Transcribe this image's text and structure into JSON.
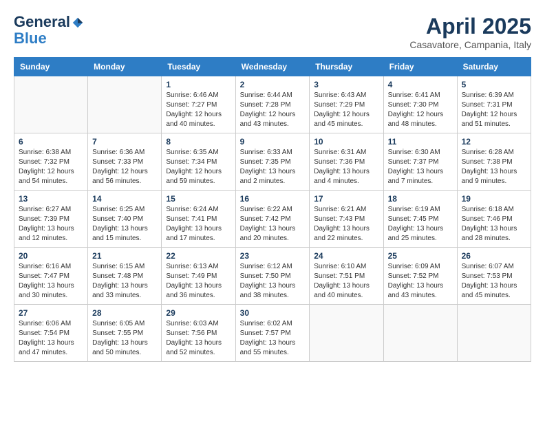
{
  "header": {
    "logo_line1": "General",
    "logo_line2": "Blue",
    "month": "April 2025",
    "location": "Casavatore, Campania, Italy"
  },
  "days_of_week": [
    "Sunday",
    "Monday",
    "Tuesday",
    "Wednesday",
    "Thursday",
    "Friday",
    "Saturday"
  ],
  "weeks": [
    [
      {
        "day": "",
        "info": ""
      },
      {
        "day": "",
        "info": ""
      },
      {
        "day": "1",
        "info": "Sunrise: 6:46 AM\nSunset: 7:27 PM\nDaylight: 12 hours\nand 40 minutes."
      },
      {
        "day": "2",
        "info": "Sunrise: 6:44 AM\nSunset: 7:28 PM\nDaylight: 12 hours\nand 43 minutes."
      },
      {
        "day": "3",
        "info": "Sunrise: 6:43 AM\nSunset: 7:29 PM\nDaylight: 12 hours\nand 45 minutes."
      },
      {
        "day": "4",
        "info": "Sunrise: 6:41 AM\nSunset: 7:30 PM\nDaylight: 12 hours\nand 48 minutes."
      },
      {
        "day": "5",
        "info": "Sunrise: 6:39 AM\nSunset: 7:31 PM\nDaylight: 12 hours\nand 51 minutes."
      }
    ],
    [
      {
        "day": "6",
        "info": "Sunrise: 6:38 AM\nSunset: 7:32 PM\nDaylight: 12 hours\nand 54 minutes."
      },
      {
        "day": "7",
        "info": "Sunrise: 6:36 AM\nSunset: 7:33 PM\nDaylight: 12 hours\nand 56 minutes."
      },
      {
        "day": "8",
        "info": "Sunrise: 6:35 AM\nSunset: 7:34 PM\nDaylight: 12 hours\nand 59 minutes."
      },
      {
        "day": "9",
        "info": "Sunrise: 6:33 AM\nSunset: 7:35 PM\nDaylight: 13 hours\nand 2 minutes."
      },
      {
        "day": "10",
        "info": "Sunrise: 6:31 AM\nSunset: 7:36 PM\nDaylight: 13 hours\nand 4 minutes."
      },
      {
        "day": "11",
        "info": "Sunrise: 6:30 AM\nSunset: 7:37 PM\nDaylight: 13 hours\nand 7 minutes."
      },
      {
        "day": "12",
        "info": "Sunrise: 6:28 AM\nSunset: 7:38 PM\nDaylight: 13 hours\nand 9 minutes."
      }
    ],
    [
      {
        "day": "13",
        "info": "Sunrise: 6:27 AM\nSunset: 7:39 PM\nDaylight: 13 hours\nand 12 minutes."
      },
      {
        "day": "14",
        "info": "Sunrise: 6:25 AM\nSunset: 7:40 PM\nDaylight: 13 hours\nand 15 minutes."
      },
      {
        "day": "15",
        "info": "Sunrise: 6:24 AM\nSunset: 7:41 PM\nDaylight: 13 hours\nand 17 minutes."
      },
      {
        "day": "16",
        "info": "Sunrise: 6:22 AM\nSunset: 7:42 PM\nDaylight: 13 hours\nand 20 minutes."
      },
      {
        "day": "17",
        "info": "Sunrise: 6:21 AM\nSunset: 7:43 PM\nDaylight: 13 hours\nand 22 minutes."
      },
      {
        "day": "18",
        "info": "Sunrise: 6:19 AM\nSunset: 7:45 PM\nDaylight: 13 hours\nand 25 minutes."
      },
      {
        "day": "19",
        "info": "Sunrise: 6:18 AM\nSunset: 7:46 PM\nDaylight: 13 hours\nand 28 minutes."
      }
    ],
    [
      {
        "day": "20",
        "info": "Sunrise: 6:16 AM\nSunset: 7:47 PM\nDaylight: 13 hours\nand 30 minutes."
      },
      {
        "day": "21",
        "info": "Sunrise: 6:15 AM\nSunset: 7:48 PM\nDaylight: 13 hours\nand 33 minutes."
      },
      {
        "day": "22",
        "info": "Sunrise: 6:13 AM\nSunset: 7:49 PM\nDaylight: 13 hours\nand 36 minutes."
      },
      {
        "day": "23",
        "info": "Sunrise: 6:12 AM\nSunset: 7:50 PM\nDaylight: 13 hours\nand 38 minutes."
      },
      {
        "day": "24",
        "info": "Sunrise: 6:10 AM\nSunset: 7:51 PM\nDaylight: 13 hours\nand 40 minutes."
      },
      {
        "day": "25",
        "info": "Sunrise: 6:09 AM\nSunset: 7:52 PM\nDaylight: 13 hours\nand 43 minutes."
      },
      {
        "day": "26",
        "info": "Sunrise: 6:07 AM\nSunset: 7:53 PM\nDaylight: 13 hours\nand 45 minutes."
      }
    ],
    [
      {
        "day": "27",
        "info": "Sunrise: 6:06 AM\nSunset: 7:54 PM\nDaylight: 13 hours\nand 47 minutes."
      },
      {
        "day": "28",
        "info": "Sunrise: 6:05 AM\nSunset: 7:55 PM\nDaylight: 13 hours\nand 50 minutes."
      },
      {
        "day": "29",
        "info": "Sunrise: 6:03 AM\nSunset: 7:56 PM\nDaylight: 13 hours\nand 52 minutes."
      },
      {
        "day": "30",
        "info": "Sunrise: 6:02 AM\nSunset: 7:57 PM\nDaylight: 13 hours\nand 55 minutes."
      },
      {
        "day": "",
        "info": ""
      },
      {
        "day": "",
        "info": ""
      },
      {
        "day": "",
        "info": ""
      }
    ]
  ]
}
